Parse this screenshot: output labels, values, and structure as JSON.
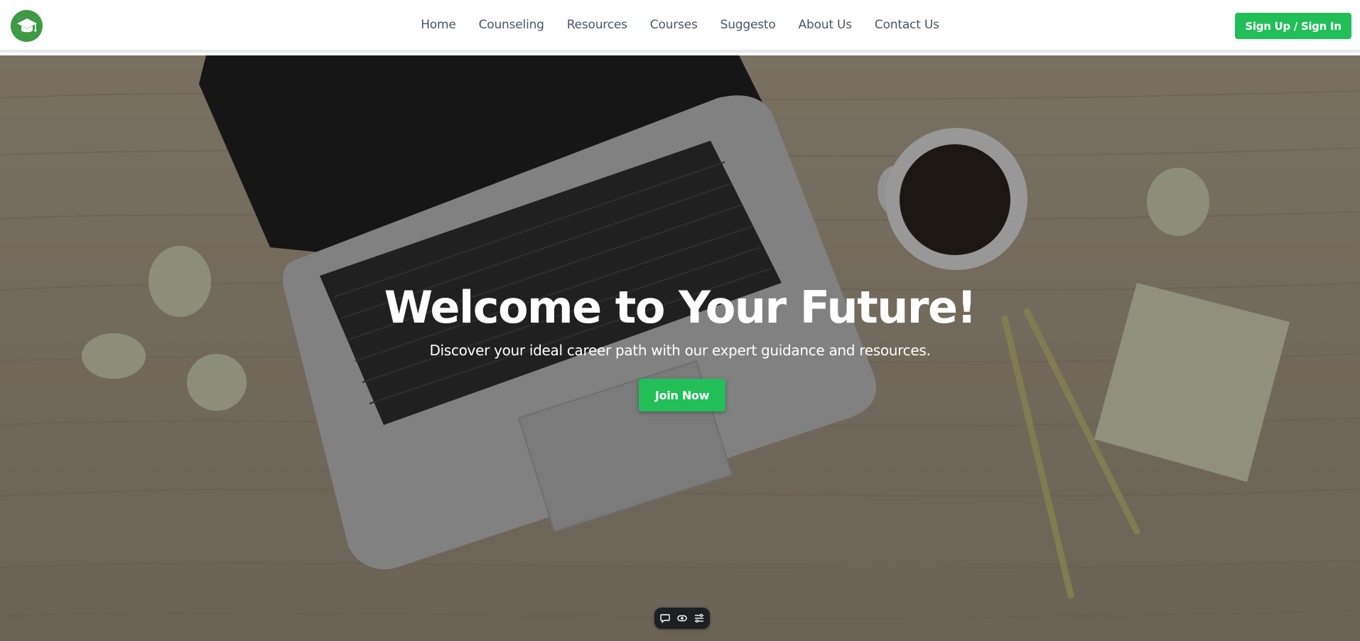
{
  "navbar": {
    "links": [
      "Home",
      "Counseling",
      "Resources",
      "Courses",
      "Suggesto",
      "About Us",
      "Contact Us"
    ],
    "signin_label": "Sign Up / Sign In",
    "logo_icon": "graduation-cap-icon"
  },
  "hero": {
    "title": "Welcome to Your Future!",
    "subtitle": "Discover your ideal career path with our expert guidance and resources.",
    "cta_label": "Join Now"
  },
  "toolbar": {
    "icons": [
      "chat-icon",
      "eye-icon",
      "settings-sliders-icon"
    ]
  },
  "colors": {
    "accent": "#22bf59",
    "logo_bg": "#3f9a45",
    "nav_text": "#4a5568"
  }
}
